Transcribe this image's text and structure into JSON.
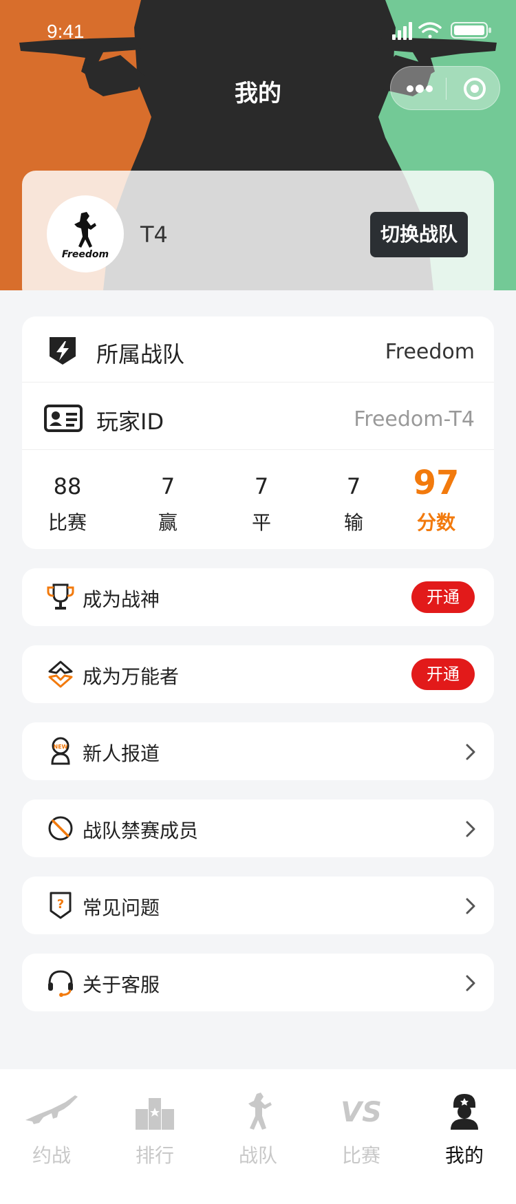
{
  "status_bar": {
    "time": "9:41"
  },
  "header": {
    "title": "我的"
  },
  "profile": {
    "player_name": "T4",
    "switch_team_label": "切换战队",
    "avatar_text": "Freedom"
  },
  "info": {
    "team_label": "所属战队",
    "team_value": "Freedom",
    "player_id_label": "玩家ID",
    "player_id_value": "Freedom-T4"
  },
  "stats": [
    {
      "value": "88",
      "label": "比赛"
    },
    {
      "value": "7",
      "label": "赢"
    },
    {
      "value": "7",
      "label": "平"
    },
    {
      "value": "7",
      "label": "输"
    },
    {
      "value": "97",
      "label": "分数"
    }
  ],
  "menu": [
    {
      "label": "成为战神",
      "badge": "开通",
      "icon": "trophy-icon"
    },
    {
      "label": "成为万能者",
      "badge": "开通",
      "icon": "diamond-icon"
    },
    {
      "label": "新人报道",
      "icon": "new-user-icon"
    },
    {
      "label": "战队禁赛成员",
      "icon": "ban-icon"
    },
    {
      "label": "常见问题",
      "icon": "question-icon"
    },
    {
      "label": "关于客服",
      "icon": "headset-icon"
    }
  ],
  "tabs": [
    {
      "label": "约战",
      "icon": "rifle-icon"
    },
    {
      "label": "排行",
      "icon": "podium-icon"
    },
    {
      "label": "战队",
      "icon": "soldier-icon"
    },
    {
      "label": "比赛",
      "icon": "vs-icon"
    },
    {
      "label": "我的",
      "icon": "profile-soldier-icon",
      "active": true
    }
  ],
  "colors": {
    "hero_left": "#d86e2c",
    "hero_right": "#73c996",
    "accent_orange": "#f27a0d",
    "badge_red": "#e21a1a",
    "dark_button": "#2b2f33"
  }
}
